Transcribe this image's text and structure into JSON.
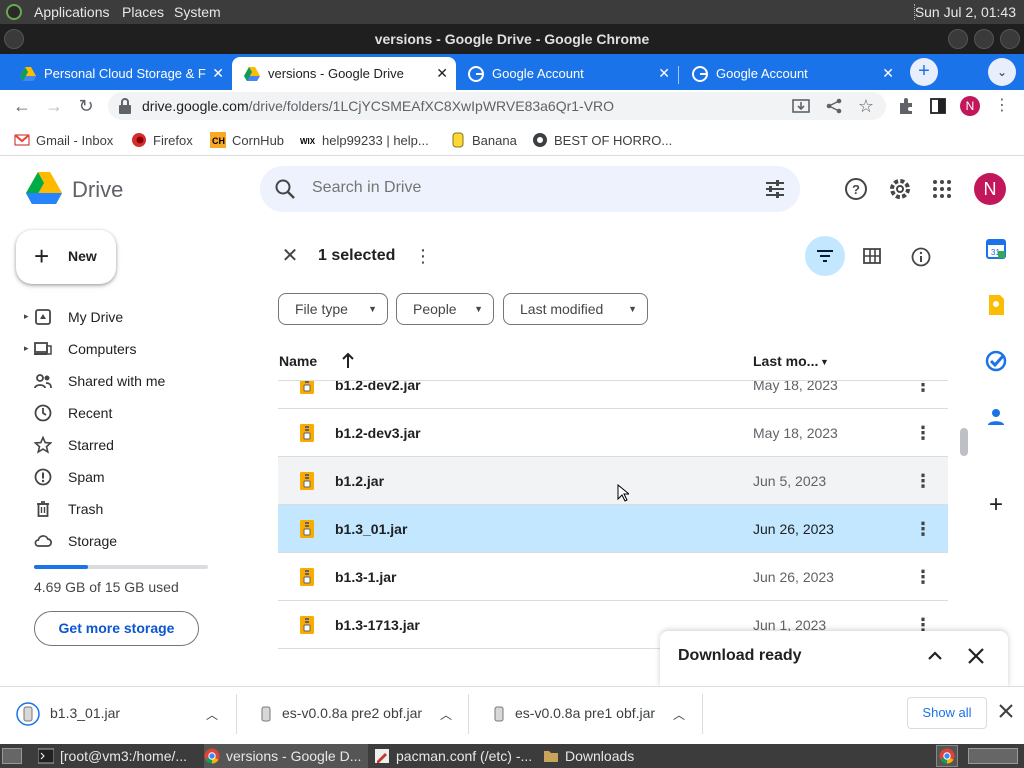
{
  "os_panel": {
    "menus": [
      "Applications",
      "Places",
      "System"
    ],
    "clock": "Sun Jul  2, 01:43"
  },
  "window": {
    "title": "versions - Google Drive - Google Chrome"
  },
  "tabs": [
    {
      "label": "Personal Cloud Storage & F",
      "favicon": "google-drive-icon",
      "active": false
    },
    {
      "label": "versions - Google Drive",
      "favicon": "google-drive-icon",
      "active": true
    },
    {
      "label": "Google Account",
      "favicon": "google-icon",
      "active": false
    },
    {
      "label": "Google Account",
      "favicon": "google-icon",
      "active": false
    }
  ],
  "toolbar": {
    "url_host": "drive.google.com",
    "url_path": "/drive/folders/1LCjYCSMEAfXC8XwIpWRVE83a6Qr1-VRO",
    "profile_initial": "N"
  },
  "bookmarks": [
    {
      "label": "Gmail - Inbox",
      "icon": "gmail-icon"
    },
    {
      "label": "Firefox",
      "icon": "firefox-icon"
    },
    {
      "label": "CornHub",
      "icon": "ch-icon"
    },
    {
      "label": "help99233 | help...",
      "icon": "wix-icon"
    },
    {
      "label": "Banana",
      "icon": "banana-icon"
    },
    {
      "label": "BEST OF HORRO...",
      "icon": "globe-icon"
    }
  ],
  "drive": {
    "app_name": "Drive",
    "search_placeholder": "Search in Drive",
    "avatar_initial": "N",
    "new_label": "New",
    "nav": [
      {
        "label": "My Drive",
        "icon": "my-drive-icon",
        "caret": true
      },
      {
        "label": "Computers",
        "icon": "computers-icon",
        "caret": true
      },
      {
        "label": "Shared with me",
        "icon": "shared-icon",
        "caret": false
      },
      {
        "label": "Recent",
        "icon": "clock-icon",
        "caret": false
      },
      {
        "label": "Starred",
        "icon": "star-icon",
        "caret": false
      },
      {
        "label": "Spam",
        "icon": "spam-icon",
        "caret": false
      },
      {
        "label": "Trash",
        "icon": "trash-icon",
        "caret": false
      },
      {
        "label": "Storage",
        "icon": "cloud-icon",
        "caret": false
      }
    ],
    "storage": {
      "used_text": "4.69 GB of 15 GB used",
      "used_fraction": 0.313
    },
    "get_storage_label": "Get more storage",
    "selection": {
      "count_label": "1 selected"
    },
    "filters": [
      "File type",
      "People",
      "Last modified"
    ],
    "columns": {
      "name": "Name",
      "modified": "Last mo..."
    },
    "files": [
      {
        "name": "b1.2-dev2.jar",
        "modified": "May 18, 2023",
        "state": "normal"
      },
      {
        "name": "b1.2-dev3.jar",
        "modified": "May 18, 2023",
        "state": "normal"
      },
      {
        "name": "b1.2.jar",
        "modified": "Jun 5, 2023",
        "state": "hover"
      },
      {
        "name": "b1.3_01.jar",
        "modified": "Jun 26, 2023",
        "state": "selected"
      },
      {
        "name": "b1.3-1.jar",
        "modified": "Jun 26, 2023",
        "state": "normal"
      },
      {
        "name": "b1.3-1713.jar",
        "modified": "Jun 1, 2023",
        "state": "normal"
      }
    ]
  },
  "toast": {
    "title": "Download ready"
  },
  "downloads": {
    "items": [
      "b1.3_01.jar",
      "es-v0.0.8a pre2 obf.jar",
      "es-v0.0.8a pre1 obf.jar"
    ],
    "show_all_label": "Show all"
  },
  "taskbar": [
    {
      "label": "[root@vm3:/home/...",
      "icon": "terminal-icon",
      "active": false
    },
    {
      "label": "versions - Google D...",
      "icon": "chrome-icon",
      "active": true
    },
    {
      "label": "pacman.conf (/etc) -...",
      "icon": "text-editor-icon",
      "active": false
    },
    {
      "label": "Downloads",
      "icon": "folder-icon",
      "active": false
    }
  ],
  "colors": {
    "accent": "#1a73e8",
    "selected_row": "#c2e7ff",
    "avatar": "#c2185b"
  }
}
